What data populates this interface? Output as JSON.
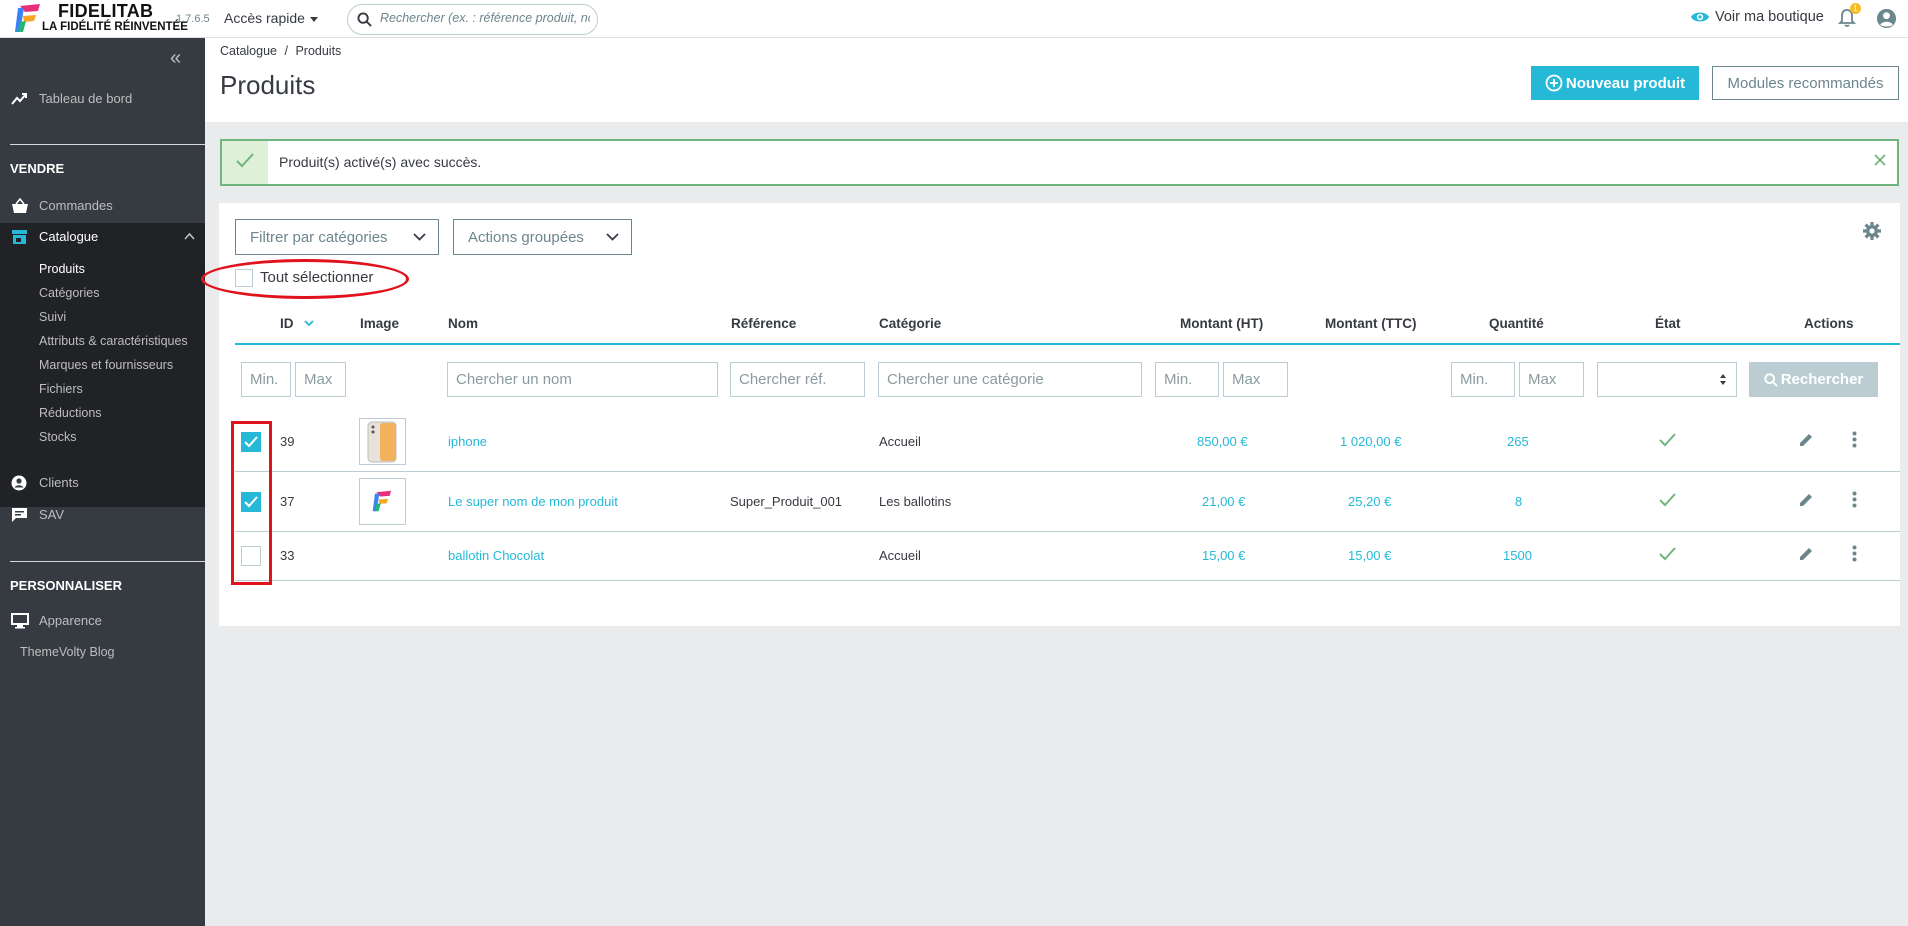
{
  "header": {
    "brand_name": "FIDELITAB",
    "brand_tagline": "LA FIDÉLITÉ RÉINVENTÉE",
    "version": "1.7.6.5",
    "quick_access": "Accès rapide",
    "search_placeholder": "Rechercher (ex. : référence produit, nom",
    "view_shop": "Voir ma boutique",
    "notifications_count": "1"
  },
  "sidebar": {
    "dashboard": "Tableau de bord",
    "section_sell": "VENDRE",
    "orders": "Commandes",
    "catalog": "Catalogue",
    "catalog_sub": [
      "Produits",
      "Catégories",
      "Suivi",
      "Attributs & caractéristiques",
      "Marques et fournisseurs",
      "Fichiers",
      "Réductions",
      "Stocks"
    ],
    "customers": "Clients",
    "support": "SAV",
    "section_customize": "PERSONNALISER",
    "appearance": "Apparence",
    "blog": "ThemeVolty Blog"
  },
  "page": {
    "breadcrumb_parent": "Catalogue",
    "breadcrumb_sep": "/",
    "breadcrumb_current": "Produits",
    "title": "Produits",
    "new_product": "Nouveau produit",
    "recommended_modules": "Modules recommandés"
  },
  "alert": {
    "message": "Produit(s) activé(s) avec succès."
  },
  "toolbar": {
    "filter_categories": "Filtrer par catégories",
    "bulk_actions": "Actions groupées",
    "select_all": "Tout sélectionner"
  },
  "table": {
    "headers": {
      "id": "ID",
      "image": "Image",
      "name": "Nom",
      "reference": "Référence",
      "category": "Catégorie",
      "price_ht": "Montant (HT)",
      "price_ttc": "Montant (TTC)",
      "quantity": "Quantité",
      "status": "État",
      "actions": "Actions"
    },
    "filters": {
      "min": "Min.",
      "max": "Max",
      "search_name": "Chercher un nom",
      "search_ref": "Chercher réf.",
      "search_category": "Chercher une catégorie",
      "search_button": "Rechercher"
    },
    "rows": [
      {
        "checked": true,
        "id": "39",
        "name": "iphone",
        "reference": "",
        "category": "Accueil",
        "price_ht": "850,00 €",
        "price_ttc": "1 020,00 €",
        "quantity": "265",
        "active": true
      },
      {
        "checked": true,
        "id": "37",
        "name": "Le super nom de mon produit",
        "reference": "Super_Produit_001",
        "category": "Les ballotins",
        "price_ht": "21,00 €",
        "price_ttc": "25,20 €",
        "quantity": "8",
        "active": true
      },
      {
        "checked": false,
        "id": "33",
        "name": "ballotin Chocolat",
        "reference": "",
        "category": "Accueil",
        "price_ht": "15,00 €",
        "price_ttc": "15,00 €",
        "quantity": "1500",
        "active": true
      }
    ]
  },
  "colors": {
    "accent": "#25b9d7",
    "sidebar": "#363a41",
    "success": "#70b580",
    "annotation": "#e0121b"
  }
}
